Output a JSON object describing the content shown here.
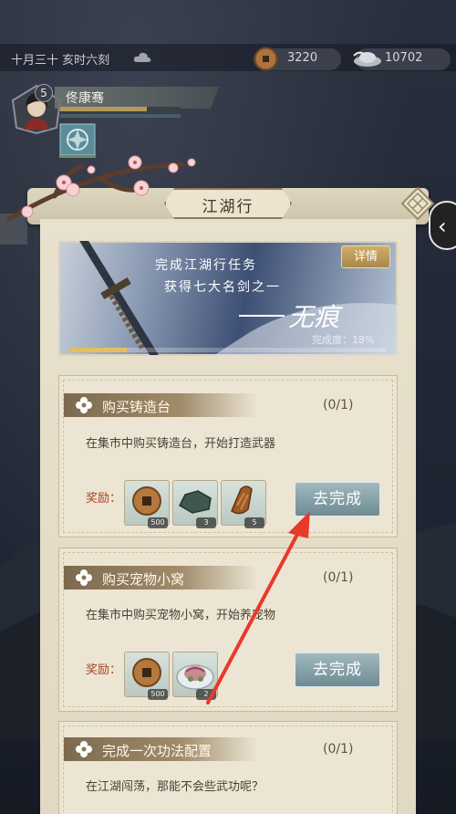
{
  "status_bar": {
    "date": "十月三十  亥时六刻",
    "weather_icon": "cloud-icon",
    "currency": [
      {
        "icon": "copper-coin-icon",
        "value": "3220"
      },
      {
        "icon": "silver-ingot-icon",
        "value": "10702"
      }
    ]
  },
  "player": {
    "level": "5",
    "name": "佟康骞",
    "hp_fraction": 0.72,
    "avatar_icon": "character-portrait-icon",
    "skill_icon": "jade-skill-icon"
  },
  "panel": {
    "title": "江湖行",
    "banner": {
      "line1": "完成江湖行任务",
      "line2": "获得七大名剑之一",
      "sword_name": "无痕",
      "detail_button": "详情",
      "progress_text": "完成度：18%",
      "progress_fraction": 0.18
    },
    "tasks": [
      {
        "name": "购买铸造台",
        "count": "(0/1)",
        "desc": "在集市中购买铸造台，开始打造武器",
        "reward_label": "奖励：",
        "rewards": [
          {
            "icon": "copper-coin-icon",
            "qty": "500"
          },
          {
            "icon": "iron-ore-icon",
            "qty": "3"
          },
          {
            "icon": "wood-log-icon",
            "qty": "5"
          }
        ],
        "button": "去完成"
      },
      {
        "name": "购买宠物小窝",
        "count": "(0/1)",
        "desc": "在集市中购买宠物小窝，开始养宠物",
        "reward_label": "奖励：",
        "rewards": [
          {
            "icon": "copper-coin-icon",
            "qty": "500"
          },
          {
            "icon": "meat-dish-icon",
            "qty": "2"
          }
        ],
        "button": "去完成"
      },
      {
        "name": "完成一次功法配置",
        "count": "(0/1)",
        "desc": "在江湖闯荡，那能不会些武功呢？"
      }
    ]
  },
  "colors": {
    "parchment": "#e8e1cd",
    "task_header": "#7d6a4e",
    "reward_red": "#a8421f",
    "button_teal": "#7f9aa2",
    "annotation_arrow": "#e8392c"
  }
}
